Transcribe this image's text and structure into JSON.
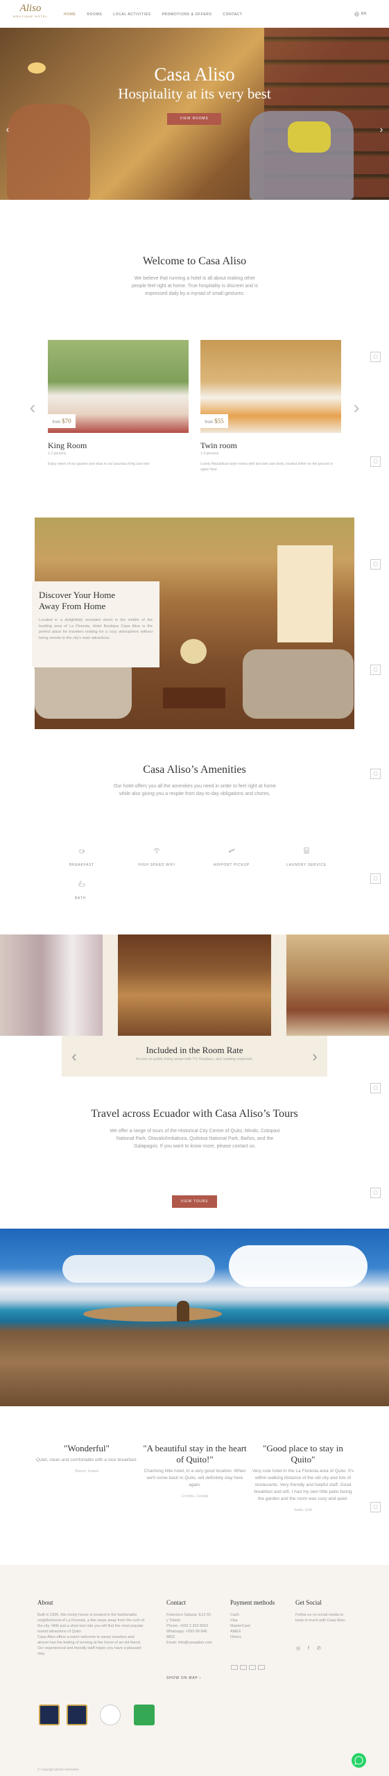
{
  "header": {
    "logo_text": "Aliso",
    "logo_subtitle": "BOUTIQUE HOTEL",
    "nav": [
      "HOME",
      "ROOMS",
      "LOCAL ACTIVITIES",
      "PROMOTIONS & OFFERS",
      "CONTACT"
    ],
    "language": "EN",
    "accent_color": "#9a7b47"
  },
  "hero": {
    "title": "Casa Aliso",
    "subtitle": "Hospitality at its very best",
    "button": "VIEW ROOMS",
    "button_color": "#b0584a"
  },
  "welcome": {
    "title": "Welcome to Casa Aliso",
    "text": "We believe that running a hotel is all about making other people feel right at home. True hospitality is discreet and is expressed daily by a myriad of small gestures."
  },
  "rooms": [
    {
      "name": "King Room",
      "size": "1-2 persons",
      "price_prefix": "from",
      "price": "$70",
      "desc": "Enjoy views of our garden and relax in our luxurious King size bed"
    },
    {
      "name": "Twin room",
      "size": "1-3 persons",
      "price_prefix": "from",
      "price": "$55",
      "desc": "Lovely Republican-style rooms with two twin size beds, located either on the ground or upper floor."
    }
  ],
  "discover": {
    "title_line1": "Discover Your Home",
    "title_line2": "Away From Home",
    "text": "Located in a delightfully secluded street in the middle of the bustling area of La Floresta, Hotel Boutique Casa Aliso is the perfect place for travelers looking for a cozy atmosphere without being remote to the city’s main attractions."
  },
  "amenities": {
    "title": "Casa Aliso’s Amenities",
    "text": "Our hotel offers you all the amenities you need in order to feel right at home while also giving you a respite from day-to-day obligations and chores.",
    "items": [
      {
        "label": "BREAKFAST",
        "icon": "breakfast-icon"
      },
      {
        "label": "HIGH SPEED WIFI",
        "icon": "wifi-icon"
      },
      {
        "label": "AIRPORT PICKUP",
        "icon": "plane-icon"
      },
      {
        "label": "LAUNDRY SERVICE",
        "icon": "laundry-icon"
      },
      {
        "label": "BATH",
        "icon": "bath-icon"
      }
    ]
  },
  "gallery": {
    "title": "Included in the Room Rate",
    "subtitle": "Access to public living areas with TV, fireplace, and reading materials."
  },
  "tours": {
    "title": "Travel across Ecuador with Casa Aliso’s Tours",
    "text": "We offer a range of tours of the Historical City Centre of Quito, Mindo, Cotopaxi National Park, Otavalo/Imbabura, Quilotoa National Park, Baños, and the Galapagos. If you want to know more, please contact us.",
    "button": "VIEW TOURS"
  },
  "reviews": [
    {
      "title": "\"Wonderful\"",
      "text": "Quiet, clean and comfortable with a nice breakfast.",
      "author": "Sharon, Ireland"
    },
    {
      "title": "\"A beautiful stay in the heart of Quito!\"",
      "text": "Charming little hotel, in a very good location. When we'll come back to Quito, will definitely stay here again.",
      "author": "Cornelia, Canada"
    },
    {
      "title": "\"Good place to stay in Quito\"",
      "text": "Very cute hotel in the La Floresta area of Quito. It's within walking distance of the old city and lots of restaurants. Very friendly and helpful staff. Good breakfast and wifi. I had my own little patio facing the garden and the room was cozy and quiet.",
      "author": "Sadie, USA"
    }
  ],
  "footer": {
    "about_title": "About",
    "about_text": [
      "Built in 1936, this lovely house is located in the fashionable neighborhood of La Floresta, a few steps away from the rush of the city. With just a short taxi ride you will find the most popular tourist attractions of Quito.",
      "Casa Aliso offers a warm welcome to weary travelers and almost has the feeling of arriving at the home of an old friend.",
      "Our experienced and friendly staff hopes you have a pleasant stay."
    ],
    "contact_title": "Contact",
    "contact_lines": [
      "Francisco Salazar, E12-91",
      "y Toledo",
      "Phone: +593 2 252 8062",
      "Whatsapp: +593 99 846",
      "8802",
      "Email: info@casaaliso.com"
    ],
    "show_map": "SHOW ON MAP",
    "payment_title": "Payment methods",
    "payment_lines": [
      "Cash",
      "Visa",
      "MasterCard",
      "AMEX",
      "Diners"
    ],
    "social_title": "Get Social",
    "social_text": "Follow us on social media to keep in touch with Casa Aliso.",
    "copyright": "© Copyright Ştrokk Interactive"
  }
}
